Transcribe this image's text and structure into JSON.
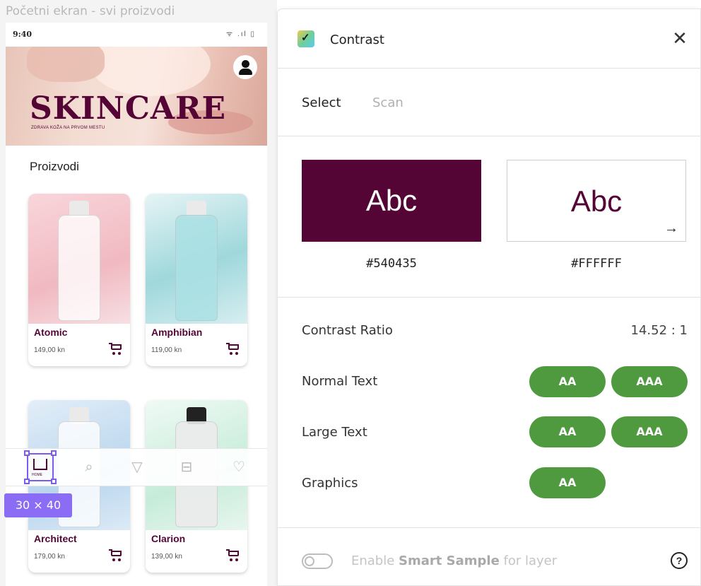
{
  "canvas": {
    "frame_title": "Početni ekran - svi proizvodi",
    "status": {
      "time": "9:40",
      "icons": "wifi-signal-battery"
    },
    "banner": {
      "brand": "SKINCARE",
      "tagline": "ZDRAVA KOŽA NA PRVOM MESTU"
    },
    "section_title": "Proizvodi",
    "products": [
      {
        "name": "Atomic",
        "price": "149,00 kn",
        "bg": "#f5c9cf"
      },
      {
        "name": "Amphibian",
        "price": "119,00 kn",
        "bg": "#bfe6e8"
      },
      {
        "name": "Architect",
        "price": "179,00 kn",
        "bg": "#cfe3f2"
      },
      {
        "name": "Clarion",
        "price": "139,00 kn",
        "bg": "#d6f1e4"
      }
    ],
    "nav": {
      "home_label": "HOME",
      "items": [
        "home-icon",
        "search-icon",
        "filter-icon",
        "cart-icon",
        "heart-icon"
      ]
    },
    "size_badge": "30 × 40"
  },
  "panel": {
    "title": "Contrast",
    "close_glyph": "✕",
    "tabs": {
      "active": "Select",
      "inactive": "Scan"
    },
    "foreground": {
      "sample": "Abc",
      "hex": "#540435",
      "color": "#540435"
    },
    "background": {
      "sample": "Abc",
      "hex": "#FFFFFF",
      "color": "#FFFFFF",
      "arrow": "→"
    },
    "ratio": {
      "label": "Contrast Ratio",
      "value": "14.52 : 1"
    },
    "rows": [
      {
        "label": "Normal Text",
        "badges": [
          "AA",
          "AAA"
        ]
      },
      {
        "label": "Large Text",
        "badges": [
          "AA",
          "AAA"
        ]
      },
      {
        "label": "Graphics",
        "badges": [
          "AA"
        ]
      }
    ],
    "footer": {
      "prefix": "Enable ",
      "bold": "Smart Sample",
      "suffix": " for layer",
      "help": "?"
    },
    "pass_color": "#4f9a3f"
  }
}
